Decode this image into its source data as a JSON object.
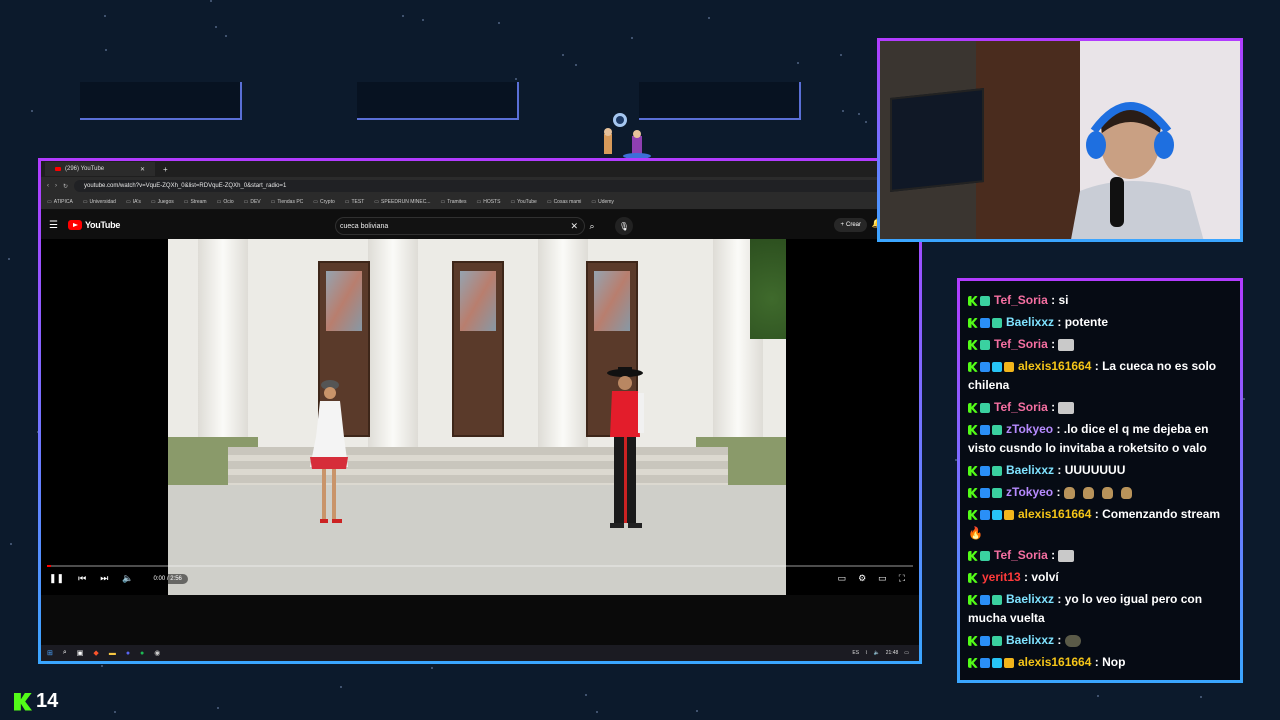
{
  "browser": {
    "tab_title": "(296) YouTube",
    "url": "youtube.com/watch?v=VquE-ZQXh_0&list=RDVquE-ZQXh_0&start_radio=1",
    "bookmarks": [
      "ATIPICA",
      "Universidad",
      "IA's",
      "Juegos",
      "Stream",
      "Ocio",
      "DEV",
      "Tiendas PC",
      "Crypto",
      "TEST",
      "SPEEDRUN MINEC...",
      "Tramites",
      "HOSTS",
      "YouTube",
      "Cosas mami",
      "Udemy"
    ],
    "bookmarks_right": "Todos"
  },
  "youtube": {
    "logo_text": "YouTube",
    "search_value": "cueca boliviana",
    "create_label": "Crear",
    "time": "0:00 / 2:56",
    "progress_fraction": 0.005
  },
  "taskbar": {
    "lang": "ES",
    "clock": "21:48"
  },
  "chat": [
    {
      "user": "Tef_Soria",
      "color": "#f56fa1",
      "badges": [
        "k",
        "sub"
      ],
      "text": "si"
    },
    {
      "user": "Baelixxz",
      "color": "#7fe3ff",
      "badges": [
        "k",
        "gift",
        "sub"
      ],
      "text": "potente"
    },
    {
      "user": "Tef_Soria",
      "color": "#f56fa1",
      "badges": [
        "k",
        "sub"
      ],
      "text": "",
      "emote": "light"
    },
    {
      "user": "alexis161664",
      "color": "#f5c518",
      "badges": [
        "k",
        "gift",
        "og",
        "vip"
      ],
      "text": "La cueca no es solo chilena"
    },
    {
      "user": "Tef_Soria",
      "color": "#f56fa1",
      "badges": [
        "k",
        "sub"
      ],
      "text": "",
      "emote": "light"
    },
    {
      "user": "zTokyeo",
      "color": "#b78bff",
      "badges": [
        "k",
        "gift",
        "sub"
      ],
      "text": ".lo dice el q me dejeba en visto cusndo lo invitaba a roketsito o valo"
    },
    {
      "user": "Baelixxz",
      "color": "#7fe3ff",
      "badges": [
        "k",
        "gift",
        "sub"
      ],
      "text": "UUUUUUU"
    },
    {
      "user": "zTokyeo",
      "color": "#b78bff",
      "badges": [
        "k",
        "gift",
        "sub"
      ],
      "text": "",
      "emote": "bags"
    },
    {
      "user": "alexis161664",
      "color": "#f5c518",
      "badges": [
        "k",
        "gift",
        "og",
        "vip"
      ],
      "text": "Comenzando stream",
      "fire": true
    },
    {
      "user": "Tef_Soria",
      "color": "#f56fa1",
      "badges": [
        "k",
        "sub"
      ],
      "text": "",
      "emote": "light"
    },
    {
      "user": "yerit13",
      "color": "#ff3b3b",
      "badges": [
        "k"
      ],
      "text": "volví"
    },
    {
      "user": "Baelixxz",
      "color": "#7fe3ff",
      "badges": [
        "k",
        "gift",
        "sub"
      ],
      "text": "yo lo veo igual pero con mucha vuelta"
    },
    {
      "user": "Baelixxz",
      "color": "#7fe3ff",
      "badges": [
        "k",
        "gift",
        "sub"
      ],
      "text": "",
      "emote": "dark"
    },
    {
      "user": "alexis161664",
      "color": "#f5c518",
      "badges": [
        "k",
        "gift",
        "og",
        "vip"
      ],
      "text": "Nop"
    }
  ],
  "viewer_count": "14",
  "accent_colors": {
    "frame_top": "#b33bff",
    "frame_bottom": "#3aa6ff",
    "kick_green": "#53fc18"
  }
}
